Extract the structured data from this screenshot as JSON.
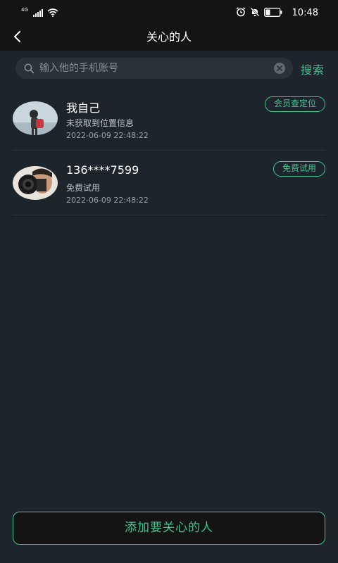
{
  "status_bar": {
    "network": "4G",
    "time": "10:48",
    "icons": [
      "signal-icon",
      "wifi-icon",
      "alarm-icon",
      "mute-icon",
      "battery-icon"
    ]
  },
  "nav": {
    "title": "关心的人",
    "back_icon": "chevron-left-icon"
  },
  "search": {
    "placeholder": "输入他的手机账号",
    "value": "",
    "button_label": "搜索"
  },
  "contacts": [
    {
      "name": "我自己",
      "status": "未获取到位置信息",
      "time": "2022-06-09 22:48:22",
      "action_label": "会员查定位"
    },
    {
      "name": "136****7599",
      "status": "免费试用",
      "time": "2022-06-09 22:48:22",
      "action_label": "免费试用"
    }
  ],
  "add_button_label": "添加要关心的人",
  "colors": {
    "accent": "#3ec58f",
    "background": "#1e242b",
    "header": "#141414"
  }
}
